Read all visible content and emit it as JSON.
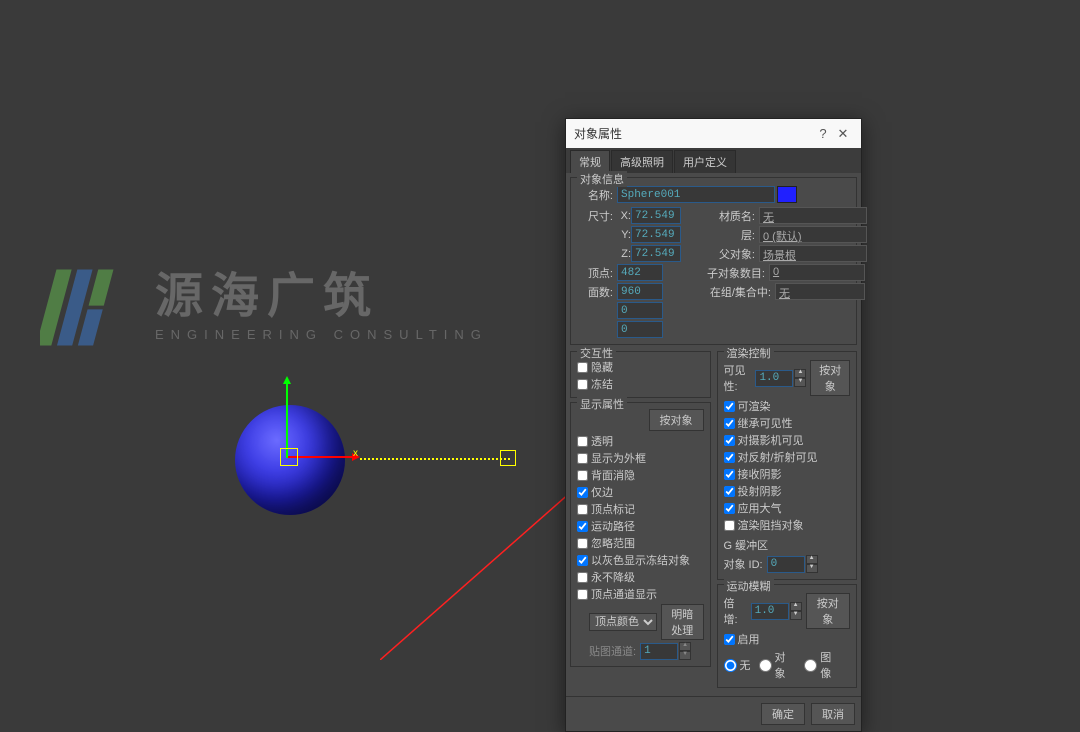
{
  "watermark": {
    "cn": "源海广筑",
    "en": "ENGINEERING CONSULTING"
  },
  "dialog": {
    "title": "对象属性",
    "tabs": {
      "general": "常规",
      "adv": "高级照明",
      "user": "用户定义"
    },
    "objinfo": {
      "title": "对象信息",
      "name_lbl": "名称:",
      "name": "Sphere001",
      "dim_lbl": "尺寸:",
      "x_lbl": "X:",
      "x": "72.549",
      "y_lbl": "Y:",
      "y": "72.549",
      "z_lbl": "Z:",
      "z": "72.549",
      "verts_lbl": "顶点:",
      "verts": "482",
      "faces_lbl": "面数:",
      "faces": "960",
      "extra1": "0",
      "extra2": "0",
      "mat_lbl": "材质名:",
      "mat": "无",
      "layer_lbl": "层:",
      "layer": "0 (默认)",
      "parent_lbl": "父对象:",
      "parent": "场景根",
      "children_lbl": "子对象数目:",
      "children": "0",
      "group_lbl": "在组/集合中:",
      "group": "无"
    },
    "interact": {
      "title": "交互性",
      "hide": "隐藏",
      "freeze": "冻结"
    },
    "display": {
      "title": "显示属性",
      "byobj": "按对象",
      "transparent": "透明",
      "wire": "显示为外框",
      "backface": "背面消隐",
      "edges": "仅边",
      "ticks": "顶点标记",
      "traj": "运动路径",
      "ignore": "忽略范围",
      "gray": "以灰色显示冻结对象",
      "never": "永不降级",
      "vchan": "顶点通道显示",
      "vcolor": "顶点颜色",
      "shaded": "明暗处理",
      "mapchan_lbl": "贴图通道:",
      "mapchan": "1"
    },
    "render": {
      "title": "渲染控制",
      "vis_lbl": "可见性:",
      "vis": "1.0",
      "byobj": "按对象",
      "renderable": "可渲染",
      "inherit": "继承可见性",
      "cam": "对摄影机可见",
      "refl": "对反射/折射可见",
      "recv": "接收阴影",
      "cast": "投射阴影",
      "atmos": "应用大气",
      "occluder": "渲染阻挡对象",
      "gbuf": "G 缓冲区",
      "objid_lbl": "对象 ID:",
      "objid": "0"
    },
    "mblur": {
      "title": "运动模糊",
      "mult_lbl": "倍增:",
      "mult": "1.0",
      "byobj": "按对象",
      "enabled": "启用",
      "none": "无",
      "object": "对象",
      "image": "图像"
    },
    "ok": "确定",
    "cancel": "取消"
  }
}
